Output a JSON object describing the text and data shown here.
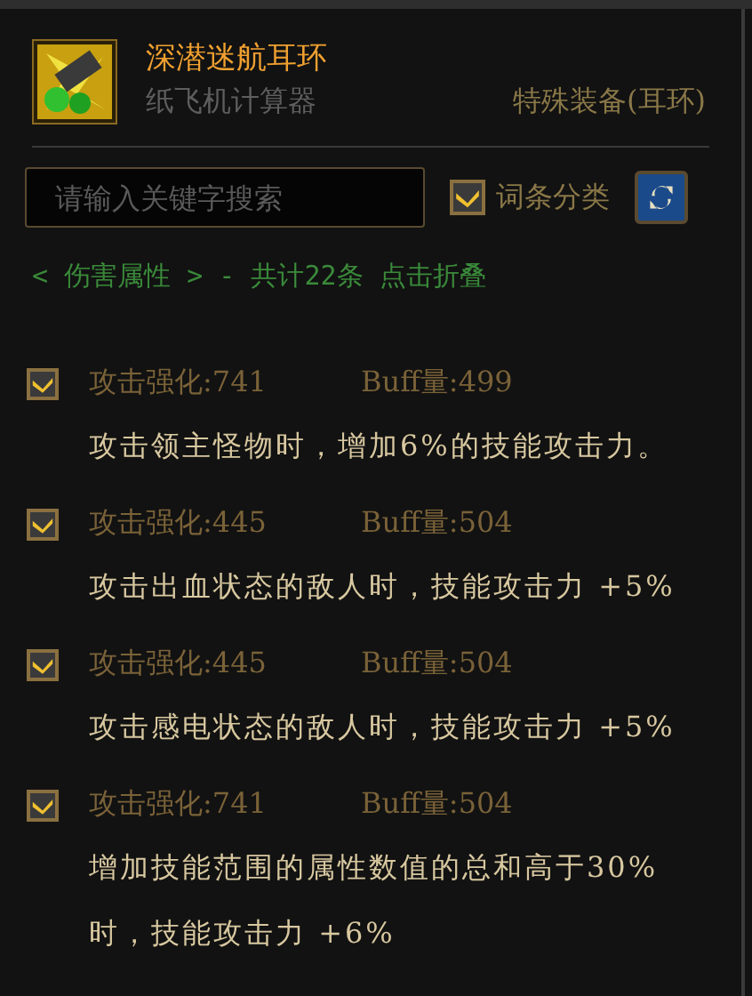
{
  "item": {
    "name": "深潜迷航耳环",
    "source": "纸飞机计算器",
    "type": "特殊装备(耳环)"
  },
  "search": {
    "placeholder": "请输入关键字搜索"
  },
  "category_toggle": {
    "label": "词条分类",
    "checked": true
  },
  "group": {
    "text": "< 伤害属性 > - 共计22条 点击折叠"
  },
  "entries": [
    {
      "checked": true,
      "attack": "攻击强化:741",
      "buff": "Buff量:499",
      "description": "攻击领主怪物时，增加6%的技能攻击力。"
    },
    {
      "checked": true,
      "attack": "攻击强化:445",
      "buff": "Buff量:504",
      "description": "攻击出血状态的敌人时，技能攻击力 +5%"
    },
    {
      "checked": true,
      "attack": "攻击强化:445",
      "buff": "Buff量:504",
      "description": "攻击感电状态的敌人时，技能攻击力 +5%"
    },
    {
      "checked": true,
      "attack": "攻击强化:741",
      "buff": "Buff量:504",
      "description": "增加技能范围的属性数值的总和高于30%时，技能攻击力 +6%"
    }
  ]
}
